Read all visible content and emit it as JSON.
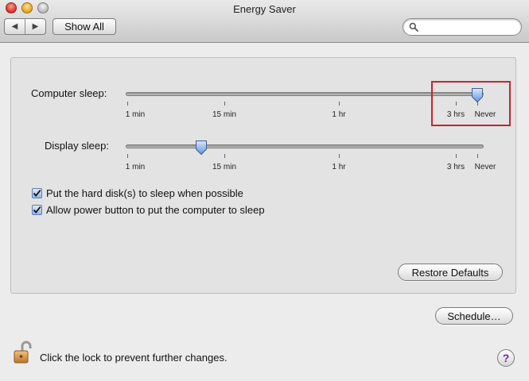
{
  "window": {
    "title": "Energy Saver"
  },
  "toolbar": {
    "back_icon": "chevron-left-icon",
    "forward_icon": "chevron-right-icon",
    "show_all_label": "Show All",
    "search": {
      "value": "",
      "placeholder": "",
      "icon": "search-icon"
    }
  },
  "computer_sleep": {
    "label": "Computer sleep:",
    "tick_labels": [
      "1 min",
      "15 min",
      "1 hr",
      "3 hrs",
      "Never"
    ],
    "selected": "Never"
  },
  "display_sleep": {
    "label": "Display sleep:",
    "tick_labels": [
      "1 min",
      "15 min",
      "1 hr",
      "3 hrs",
      "Never"
    ],
    "selected": "15 min"
  },
  "options": [
    {
      "label": "Put the hard disk(s) to sleep when possible",
      "checked": true
    },
    {
      "label": "Allow power button to put the computer to sleep",
      "checked": true
    }
  ],
  "buttons": {
    "restore_defaults": "Restore Defaults",
    "schedule": "Schedule…"
  },
  "footer": {
    "lock_text": "Click the lock to prevent further changes.",
    "lock_icon": "lock-icon",
    "help_label": "?"
  },
  "colors": {
    "highlight_box": "#c0272d",
    "checkbox_accent": "#5a7fb5",
    "help_glyph": "#6a2a9a"
  }
}
